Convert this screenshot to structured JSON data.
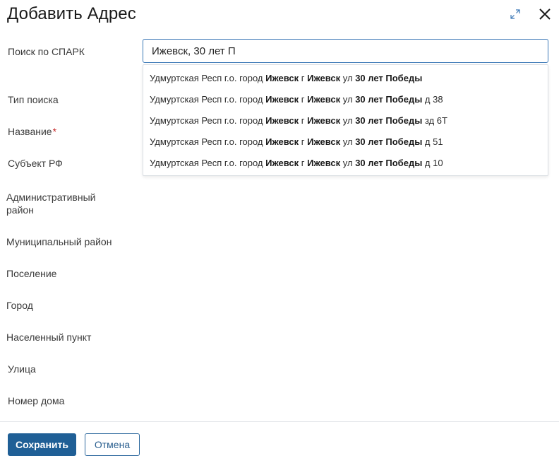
{
  "dialog": {
    "title": "Добавить Адрес"
  },
  "form": {
    "labels": {
      "spark_search": "Поиск по СПАРК",
      "search_type": "Тип поиска",
      "name": "Название",
      "name_required_mark": "*",
      "subject": "Субъект РФ",
      "admin_district": "Административный район",
      "municipal_district": "Муниципальный район",
      "settlement": "Поселение",
      "city": "Город",
      "locality": "Населенный пункт",
      "street": "Улица",
      "house_number": "Номер дома"
    },
    "search": {
      "value": "Ижевск, 30 лет П"
    },
    "suggestions": [
      {
        "prefix": "Удмуртская Респ г.о. город ",
        "b1": "Ижевск",
        "m1": " г ",
        "b2": "Ижевск",
        "m2": " ул ",
        "b3": "30 лет Победы",
        "suffix": ""
      },
      {
        "prefix": "Удмуртская Респ г.о. город ",
        "b1": "Ижевск",
        "m1": " г ",
        "b2": "Ижевск",
        "m2": " ул ",
        "b3": "30 лет Победы",
        "suffix": " д 38"
      },
      {
        "prefix": "Удмуртская Респ г.о. город ",
        "b1": "Ижевск",
        "m1": " г ",
        "b2": "Ижевск",
        "m2": " ул ",
        "b3": "30 лет Победы",
        "suffix": " зд 6Т"
      },
      {
        "prefix": "Удмуртская Респ г.о. город ",
        "b1": "Ижевск",
        "m1": " г ",
        "b2": "Ижевск",
        "m2": " ул ",
        "b3": "30 лет Победы",
        "suffix": " д 51"
      },
      {
        "prefix": "Удмуртская Респ г.о. город ",
        "b1": "Ижевск",
        "m1": " г ",
        "b2": "Ижевск",
        "m2": " ул ",
        "b3": "30 лет Победы",
        "suffix": " д 10"
      }
    ]
  },
  "footer": {
    "save_label": "Сохранить",
    "cancel_label": "Отмена"
  },
  "icons": {
    "expand": "expand-icon",
    "close": "close-icon"
  },
  "colors": {
    "primary": "#1f5f96",
    "input_focus_border": "#3b78b6",
    "required": "#c62828"
  }
}
